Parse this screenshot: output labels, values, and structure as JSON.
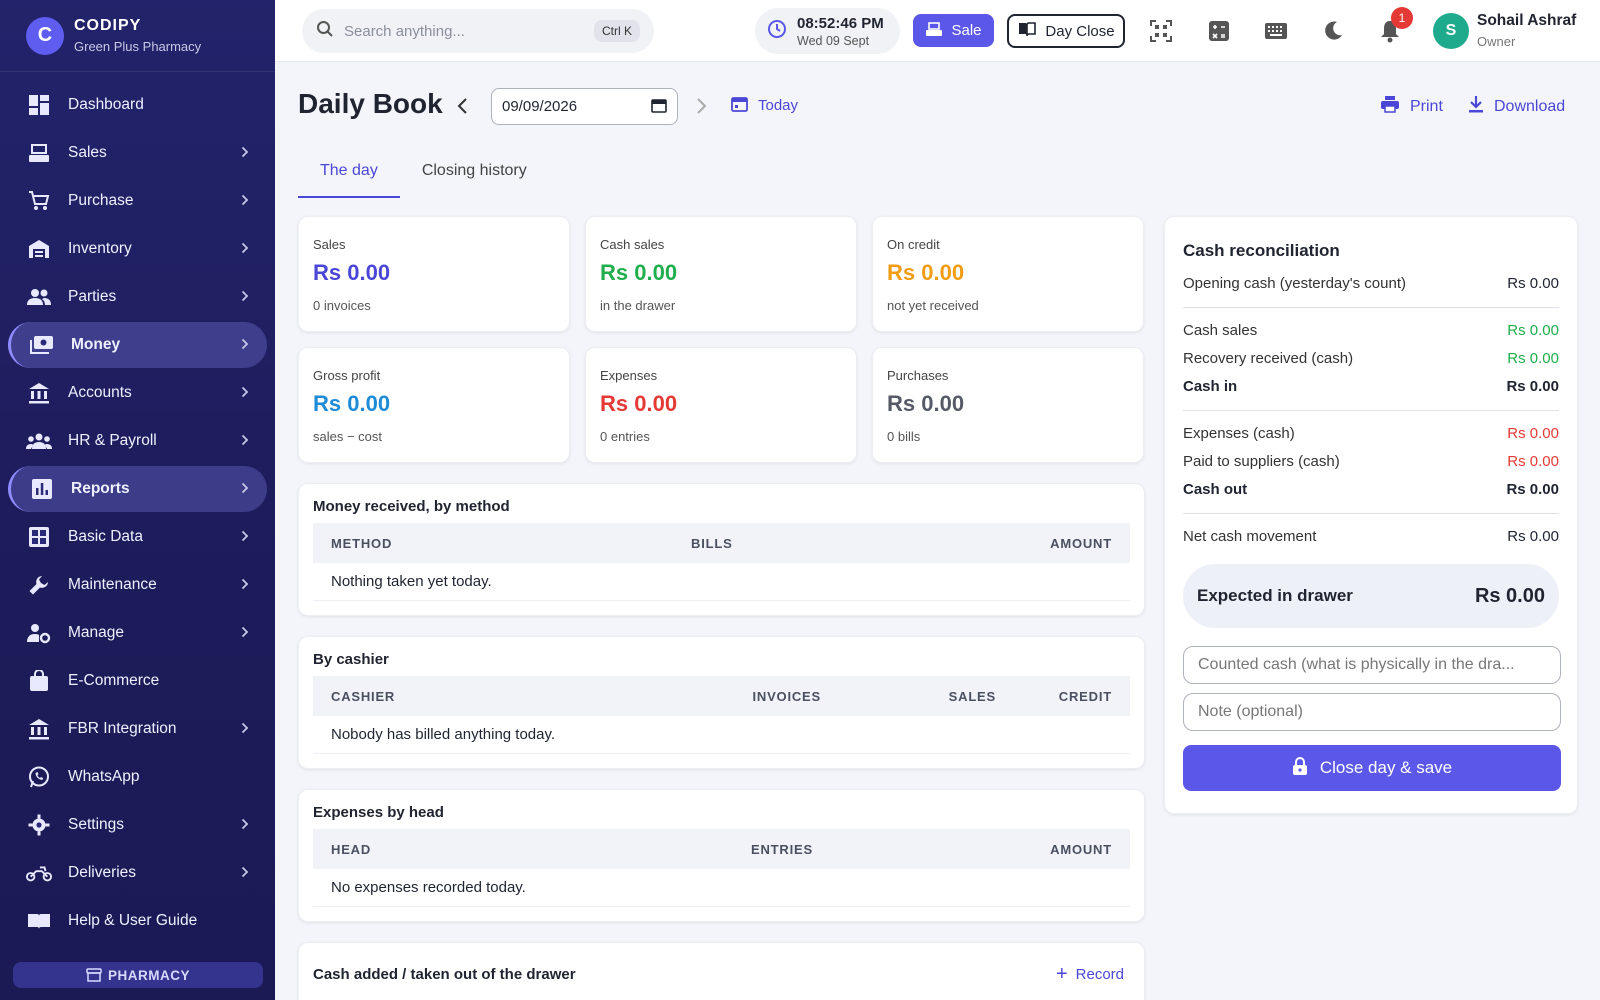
{
  "brand": {
    "logo_letter": "C",
    "name": "CODIPY",
    "subtitle": "Green Plus Pharmacy"
  },
  "sidebar": {
    "items": [
      {
        "label": "Dashboard",
        "icon": "dashboard-icon",
        "has_chevron": false,
        "active": false
      },
      {
        "label": "Sales",
        "icon": "register-icon",
        "has_chevron": true,
        "active": false
      },
      {
        "label": "Purchase",
        "icon": "cart-icon",
        "has_chevron": true,
        "active": false
      },
      {
        "label": "Inventory",
        "icon": "warehouse-icon",
        "has_chevron": true,
        "active": false
      },
      {
        "label": "Parties",
        "icon": "people-icon",
        "has_chevron": true,
        "active": false
      },
      {
        "label": "Money",
        "icon": "money-icon",
        "has_chevron": true,
        "active": true
      },
      {
        "label": "Accounts",
        "icon": "bank-icon",
        "has_chevron": true,
        "active": false
      },
      {
        "label": "HR & Payroll",
        "icon": "group-icon",
        "has_chevron": true,
        "active": false
      },
      {
        "label": "Reports",
        "icon": "bar-chart-icon",
        "has_chevron": true,
        "active": true
      },
      {
        "label": "Basic Data",
        "icon": "grid-icon",
        "has_chevron": true,
        "active": false
      },
      {
        "label": "Maintenance",
        "icon": "wrench-icon",
        "has_chevron": true,
        "active": false
      },
      {
        "label": "Manage",
        "icon": "user-gear-icon",
        "has_chevron": true,
        "active": false
      },
      {
        "label": "E-Commerce",
        "icon": "shopping-bag-icon",
        "has_chevron": false,
        "active": false
      },
      {
        "label": "FBR Integration",
        "icon": "bank-icon",
        "has_chevron": true,
        "active": false
      },
      {
        "label": "WhatsApp",
        "icon": "whatsapp-icon",
        "has_chevron": false,
        "active": false
      },
      {
        "label": "Settings",
        "icon": "gear-icon",
        "has_chevron": true,
        "active": false
      },
      {
        "label": "Deliveries",
        "icon": "motorbike-icon",
        "has_chevron": true,
        "active": false
      },
      {
        "label": "Help & User Guide",
        "icon": "book-icon",
        "has_chevron": false,
        "active": false
      }
    ],
    "badge": "PHARMACY"
  },
  "topbar": {
    "search_placeholder": "Search anything...",
    "search_shortcut": "Ctrl K",
    "clock_time": "08:52:46 PM",
    "clock_date": "Wed 09 Sept",
    "sale_label": "Sale",
    "day_close_label": "Day Close",
    "notification_count": "1",
    "user_initial": "S",
    "user_name": "Sohail Ashraf",
    "user_role": "Owner"
  },
  "header": {
    "title": "Daily Book",
    "date_value": "09/09/2026",
    "today_label": "Today",
    "print_label": "Print",
    "download_label": "Download"
  },
  "tabs": [
    {
      "label": "The day",
      "active": true
    },
    {
      "label": "Closing history",
      "active": false
    }
  ],
  "stats": [
    {
      "label": "Sales",
      "value": "Rs 0.00",
      "sub": "0 invoices",
      "color": "#4b47d6"
    },
    {
      "label": "Cash sales",
      "value": "Rs 0.00",
      "sub": "in the drawer",
      "color": "#1fae4b"
    },
    {
      "label": "On credit",
      "value": "Rs 0.00",
      "sub": "not yet received",
      "color": "#f29c11"
    },
    {
      "label": "Gross profit",
      "value": "Rs 0.00",
      "sub": "sales − cost",
      "color": "#1d8bd6"
    },
    {
      "label": "Expenses",
      "value": "Rs 0.00",
      "sub": "0 entries",
      "color": "#e53935"
    },
    {
      "label": "Purchases",
      "value": "Rs 0.00",
      "sub": "0 bills",
      "color": "#555a66"
    }
  ],
  "money_by_method": {
    "title": "Money received, by method",
    "columns": [
      "METHOD",
      "BILLS",
      "AMOUNT"
    ],
    "empty": "Nothing taken yet today."
  },
  "by_cashier": {
    "title": "By cashier",
    "columns": [
      "CASHIER",
      "INVOICES",
      "SALES",
      "CREDIT"
    ],
    "empty": "Nobody has billed anything today."
  },
  "expenses_by_head": {
    "title": "Expenses by head",
    "columns": [
      "HEAD",
      "ENTRIES",
      "AMOUNT"
    ],
    "empty": "No expenses recorded today."
  },
  "cash_drawer": {
    "title": "Cash added / taken out of the drawer",
    "record_label": "Record"
  },
  "reconciliation": {
    "title": "Cash reconciliation",
    "opening_label": "Opening cash (yesterday's count)",
    "opening_value": "Rs 0.00",
    "cash_sales_label": "Cash sales",
    "cash_sales_value": "Rs 0.00",
    "recovery_label": "Recovery received (cash)",
    "recovery_value": "Rs 0.00",
    "cash_in_label": "Cash in",
    "cash_in_value": "Rs 0.00",
    "expenses_label": "Expenses (cash)",
    "expenses_value": "Rs 0.00",
    "paid_suppliers_label": "Paid to suppliers (cash)",
    "paid_suppliers_value": "Rs 0.00",
    "cash_out_label": "Cash out",
    "cash_out_value": "Rs 0.00",
    "net_label": "Net cash movement",
    "net_value": "Rs 0.00",
    "expected_label": "Expected in drawer",
    "expected_value": "Rs 0.00",
    "counted_placeholder": "Counted cash (what is physically in the dra...",
    "note_placeholder": "Note (optional)",
    "close_button_label": "Close day & save"
  },
  "colors": {
    "accent": "#5b57e8",
    "sidebar_bg": "#1f1f62",
    "green": "#1fae4b",
    "red": "#e53935",
    "orange": "#f29c11",
    "blue": "#1d8bd6"
  }
}
